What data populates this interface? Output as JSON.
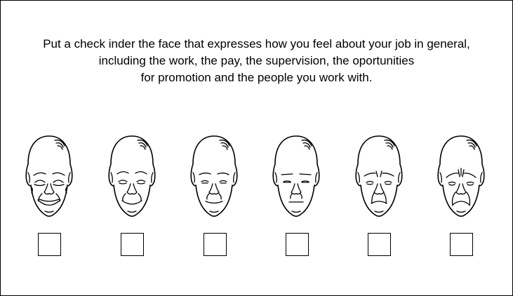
{
  "instructions": {
    "line1": "Put a check inder the face that expresses how you feel about your job in general,",
    "line2": "including the work, the pay, the supervision, the oportunities",
    "line3": "for promotion and the people you work with."
  },
  "faces": [
    {
      "expression": "very-happy"
    },
    {
      "expression": "happy"
    },
    {
      "expression": "slightly-happy"
    },
    {
      "expression": "neutral"
    },
    {
      "expression": "unhappy"
    },
    {
      "expression": "very-unhappy"
    }
  ],
  "colors": {
    "line": "#000000",
    "background": "#ffffff"
  }
}
